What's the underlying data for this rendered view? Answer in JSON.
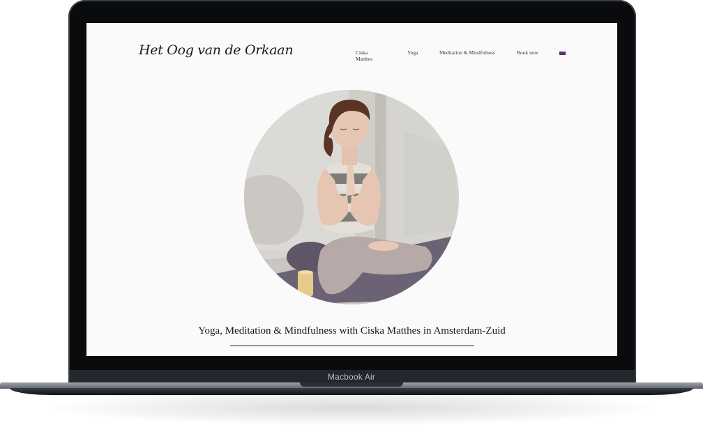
{
  "site": {
    "logo_text": "Het Oog van de Orkaan",
    "nav": [
      {
        "label": "Ciska Matthes"
      },
      {
        "label": "Yoga"
      },
      {
        "label": "Meditation & Mindfulness"
      },
      {
        "label": "Book now"
      }
    ],
    "language_icon": "uk-flag-icon",
    "tagline": "Yoga, Meditation & Mindfulness with Ciska Matthes in Amsterdam-Zuid"
  },
  "device": {
    "label": "Macbook Air"
  },
  "colors": {
    "screen_bg": "#fafafa",
    "bezel": "#0a0b0d",
    "text": "#1a1a1a"
  }
}
